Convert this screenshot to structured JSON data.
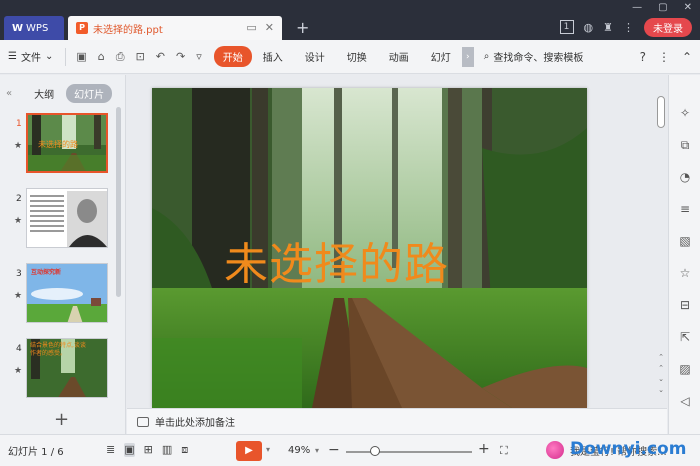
{
  "titlebar": {
    "app_tab": "WPS",
    "doc_tab": "未选择的路.ppt",
    "badge": "1",
    "login": "未登录"
  },
  "ribbon": {
    "file_menu": "文件",
    "tabs": [
      "开始",
      "插入",
      "设计",
      "切换",
      "动画",
      "幻灯"
    ],
    "active_tab": "开始",
    "search": "查找命令、搜索模板"
  },
  "left_panel": {
    "tabs": [
      "大纲",
      "幻灯片"
    ],
    "active_tab": "幻灯片",
    "thumbnails": [
      {
        "num": "1",
        "text": "未选择的路"
      },
      {
        "num": "2",
        "text": ""
      },
      {
        "num": "3",
        "text": "互动探究新"
      },
      {
        "num": "4",
        "text": "结合景色的特点,谈谈作者的感受。"
      }
    ]
  },
  "slide": {
    "title": "未选择的路"
  },
  "notes": {
    "placeholder": "单击此处添加备注"
  },
  "status": {
    "slide_count": "幻灯片 1 / 6",
    "zoom": "49%",
    "user_text": "我是莹行! 帮你搜索..."
  },
  "watermark": "Downyi.com",
  "colors": {
    "accent": "#e8552b",
    "title_orange": "#f08a1c",
    "login_red": "#e5484d"
  }
}
